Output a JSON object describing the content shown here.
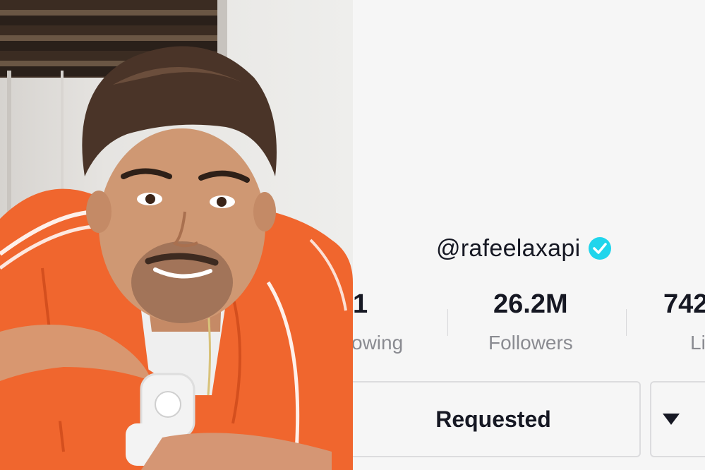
{
  "profile": {
    "username": "@rafeelaxapi",
    "verified": true,
    "verified_color": "#20d5ec",
    "stats": [
      {
        "value": "1",
        "label": "owing"
      },
      {
        "value": "26.2M",
        "label": "Followers"
      },
      {
        "value": "742",
        "label": "Li"
      }
    ]
  },
  "actions": {
    "requested_label": "Requested",
    "more_icon": "caret-down-icon"
  },
  "photo": {
    "jacket_color": "#f0662e"
  }
}
